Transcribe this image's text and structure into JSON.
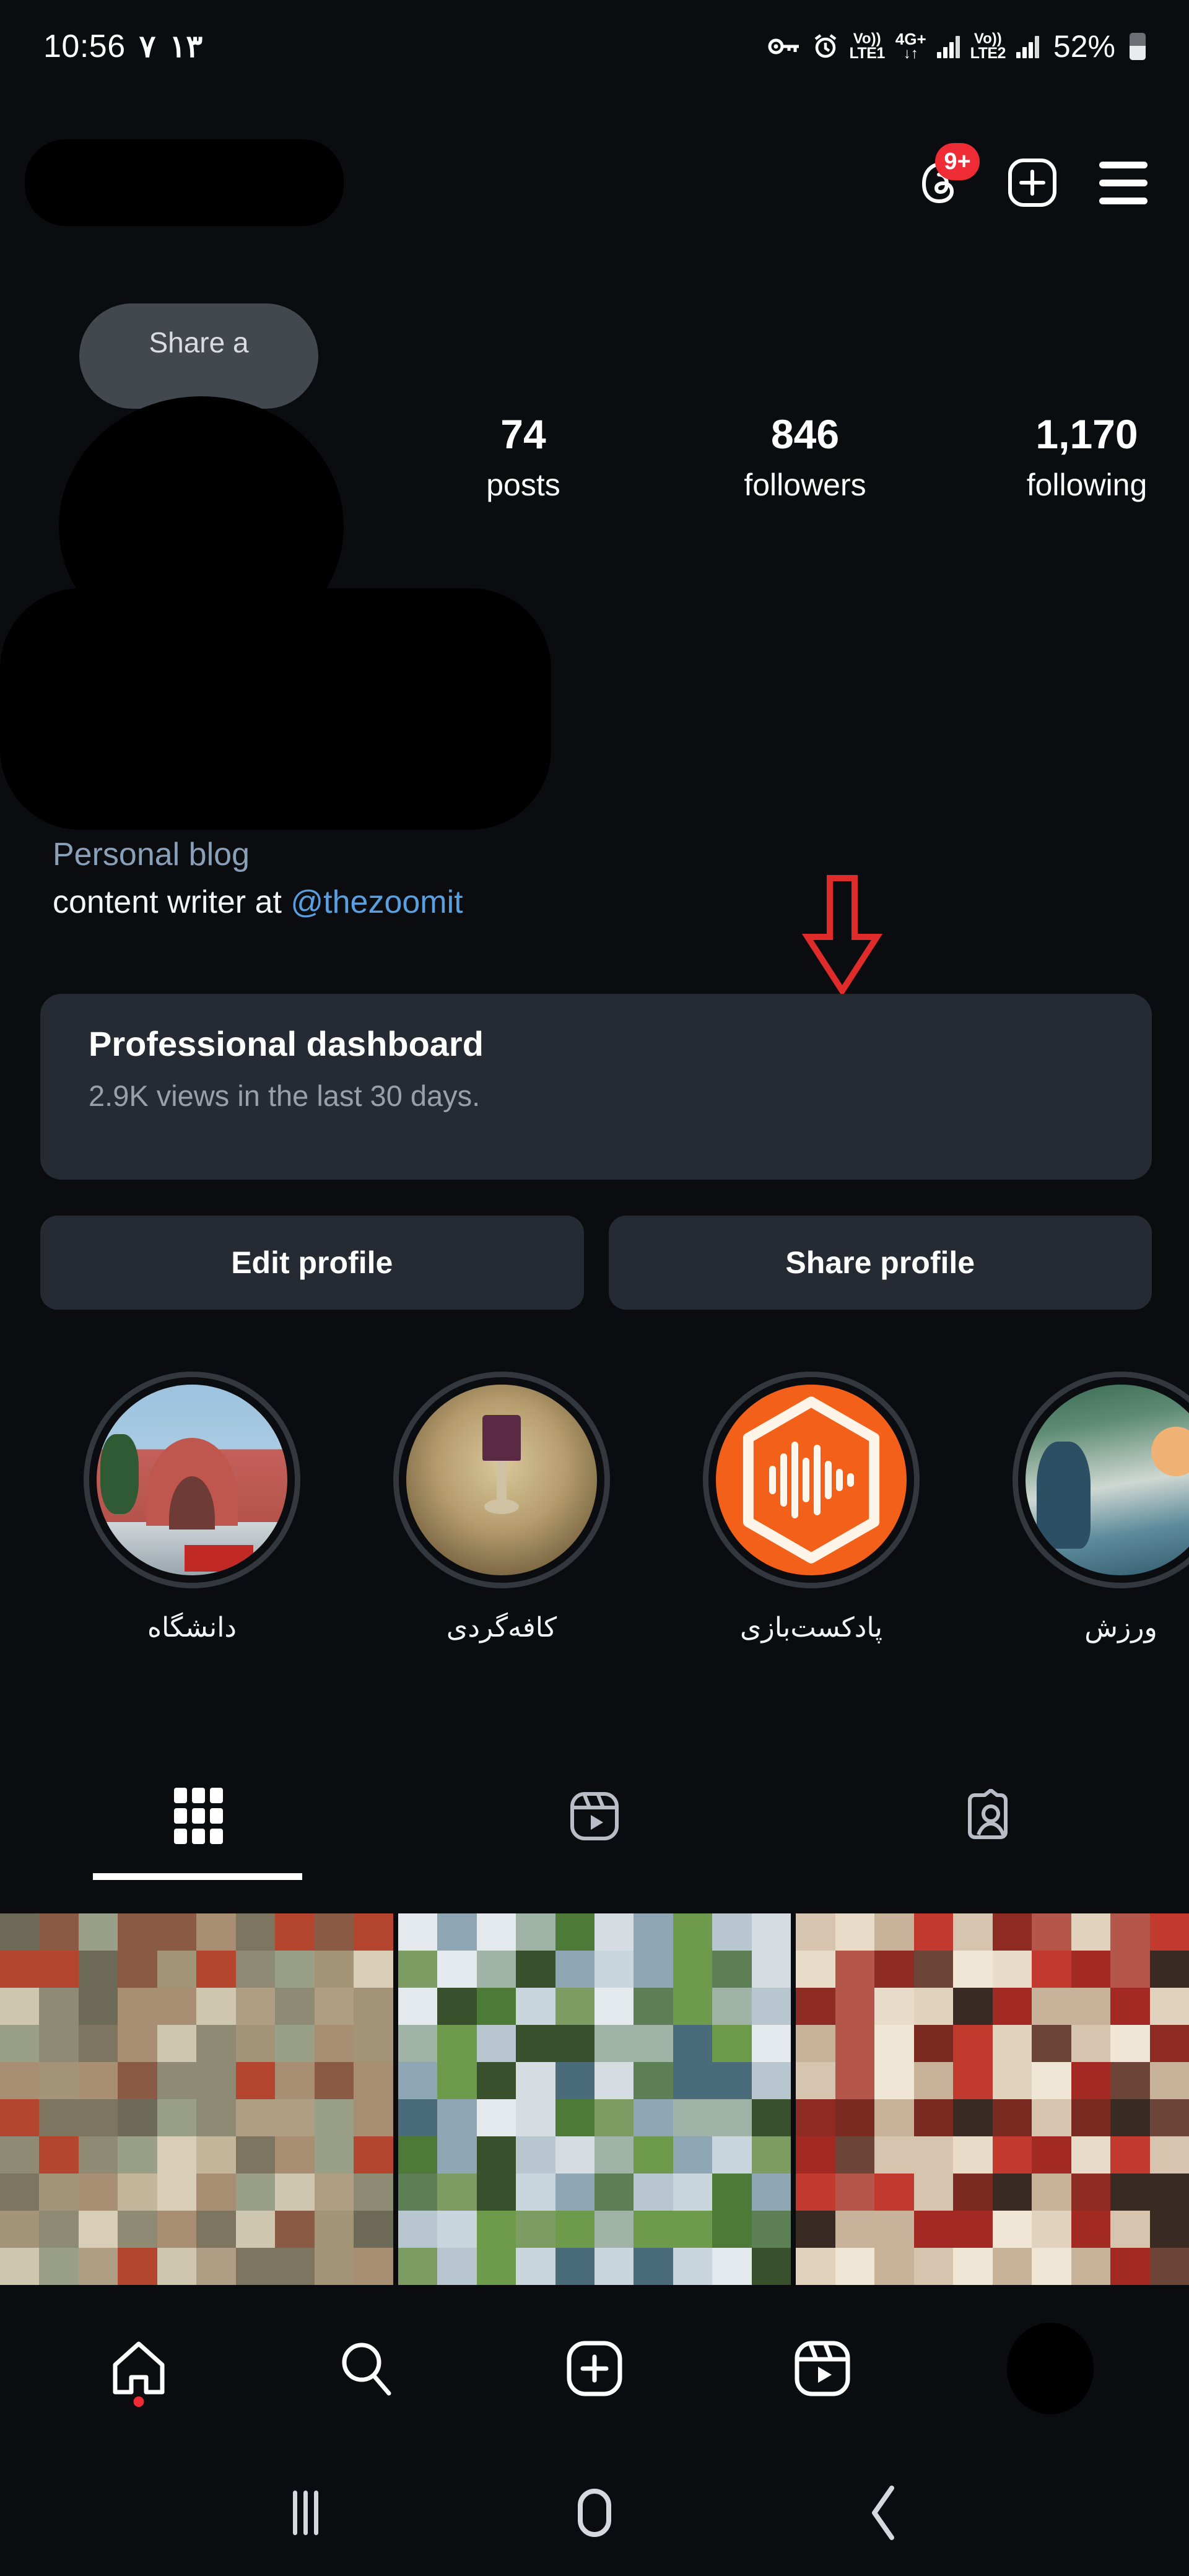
{
  "status_bar": {
    "time": "10:56",
    "glyph": "٧",
    "date_digits": "١٣",
    "key_icon": "key-icon",
    "alarm_icon": "alarm-icon",
    "volte1_top": "Vo))",
    "volte1_bottom": "LTE1",
    "network_top": "4G+",
    "network_bottom": "↓↑",
    "volte2_top": "Vo))",
    "volte2_bottom": "LTE2",
    "battery_percent": "52%"
  },
  "top_nav": {
    "username_redacted": "",
    "threads_icon": "threads-icon",
    "threads_badge": "9+",
    "add_icon": "plus-square-icon",
    "menu_icon": "hamburger-menu-icon"
  },
  "profile": {
    "note_bubble": "Share a",
    "avatar": "profile-avatar-redacted",
    "stats": [
      {
        "num": "74",
        "label": "posts"
      },
      {
        "num": "846",
        "label": "followers"
      },
      {
        "num": "1,170",
        "label": "following"
      }
    ],
    "bio": {
      "category": "Personal blog",
      "line2_prefix": "content writer at ",
      "line2_mention": "@thezoomit"
    }
  },
  "dashboard": {
    "title": "Professional dashboard",
    "subtitle": "2.9K views in the last 30 days."
  },
  "annotation": {
    "arrow": "red-down-arrow",
    "color": "#e02b2b"
  },
  "actions": {
    "edit_profile": "Edit profile",
    "share_profile": "Share profile"
  },
  "highlights": [
    {
      "label": "دانشگاه",
      "art": "university"
    },
    {
      "label": "کافه‌گردی",
      "art": "lamp"
    },
    {
      "label": "پادکست‌بازی",
      "art": "podcast"
    },
    {
      "label": "ورزش",
      "art": "sport"
    }
  ],
  "tabs": [
    {
      "name": "grid",
      "icon": "grid-icon",
      "active": true
    },
    {
      "name": "reels",
      "icon": "reels-icon",
      "active": false
    },
    {
      "name": "tagged",
      "icon": "tagged-person-icon",
      "active": false
    }
  ],
  "posts": [
    {
      "name": "post-thumbnail-1",
      "redacted": "pixelated"
    },
    {
      "name": "post-thumbnail-2",
      "redacted": "pixelated"
    },
    {
      "name": "post-thumbnail-3",
      "redacted": "pixelated"
    }
  ],
  "bottom_nav": [
    {
      "name": "home",
      "icon": "home-icon",
      "has_dot": true
    },
    {
      "name": "search",
      "icon": "search-icon",
      "has_dot": false
    },
    {
      "name": "create",
      "icon": "plus-square-icon",
      "has_dot": false
    },
    {
      "name": "reels",
      "icon": "reels-icon",
      "has_dot": false
    },
    {
      "name": "profile",
      "icon": "avatar-icon",
      "has_dot": false
    }
  ],
  "system_nav": {
    "recents": "recents-icon",
    "home": "home-pill-icon",
    "back": "back-chevron-icon"
  },
  "colors": {
    "page_bg": "#0a0c0f",
    "card_bg": "#262b33",
    "badge_red": "#ef2b35",
    "accent_blue": "#5a9fe0",
    "muted_blue": "#8aa0b8",
    "annotation_red": "#e02b2b",
    "podcast_orange": "#f2601a"
  }
}
